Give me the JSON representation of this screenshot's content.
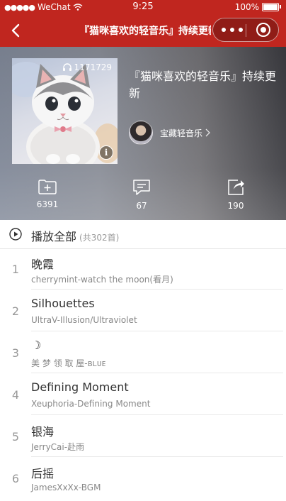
{
  "status_bar": {
    "signal": "●●●●●",
    "carrier": "WeChat",
    "time": "9:25",
    "battery": "100%"
  },
  "nav": {
    "title": "『猫咪喜欢的轻音乐』持续更新"
  },
  "playlist": {
    "title": "『猫咪喜欢的轻音乐』持续更新",
    "play_count": "1171729",
    "info_label": "i",
    "creator": "宝藏轻音乐",
    "actions": [
      {
        "icon": "add-folder-icon",
        "count": "6391"
      },
      {
        "icon": "comment-icon",
        "count": "67"
      },
      {
        "icon": "share-icon",
        "count": "190"
      }
    ]
  },
  "play_all": {
    "label": "播放全部",
    "count": "(共302首)"
  },
  "songs": [
    {
      "index": "1",
      "name": "晚霞",
      "artist": "cherrymint-watch the moon(看月)"
    },
    {
      "index": "2",
      "name": "Silhouettes",
      "artist": "UltraV-Illusion/Ultraviolet"
    },
    {
      "index": "3",
      "name": "☽",
      "artist": "美 梦 领 取 屋-ʙʟᴜᴇ"
    },
    {
      "index": "4",
      "name": "Defining Moment",
      "artist": "Xeuphoria-Defining Moment"
    },
    {
      "index": "5",
      "name": "银海",
      "artist": "JerryCai-赴雨"
    },
    {
      "index": "6",
      "name": "后摇",
      "artist": "JamesXxXx-BGM"
    }
  ],
  "colors": {
    "accent": "#c0261f"
  }
}
